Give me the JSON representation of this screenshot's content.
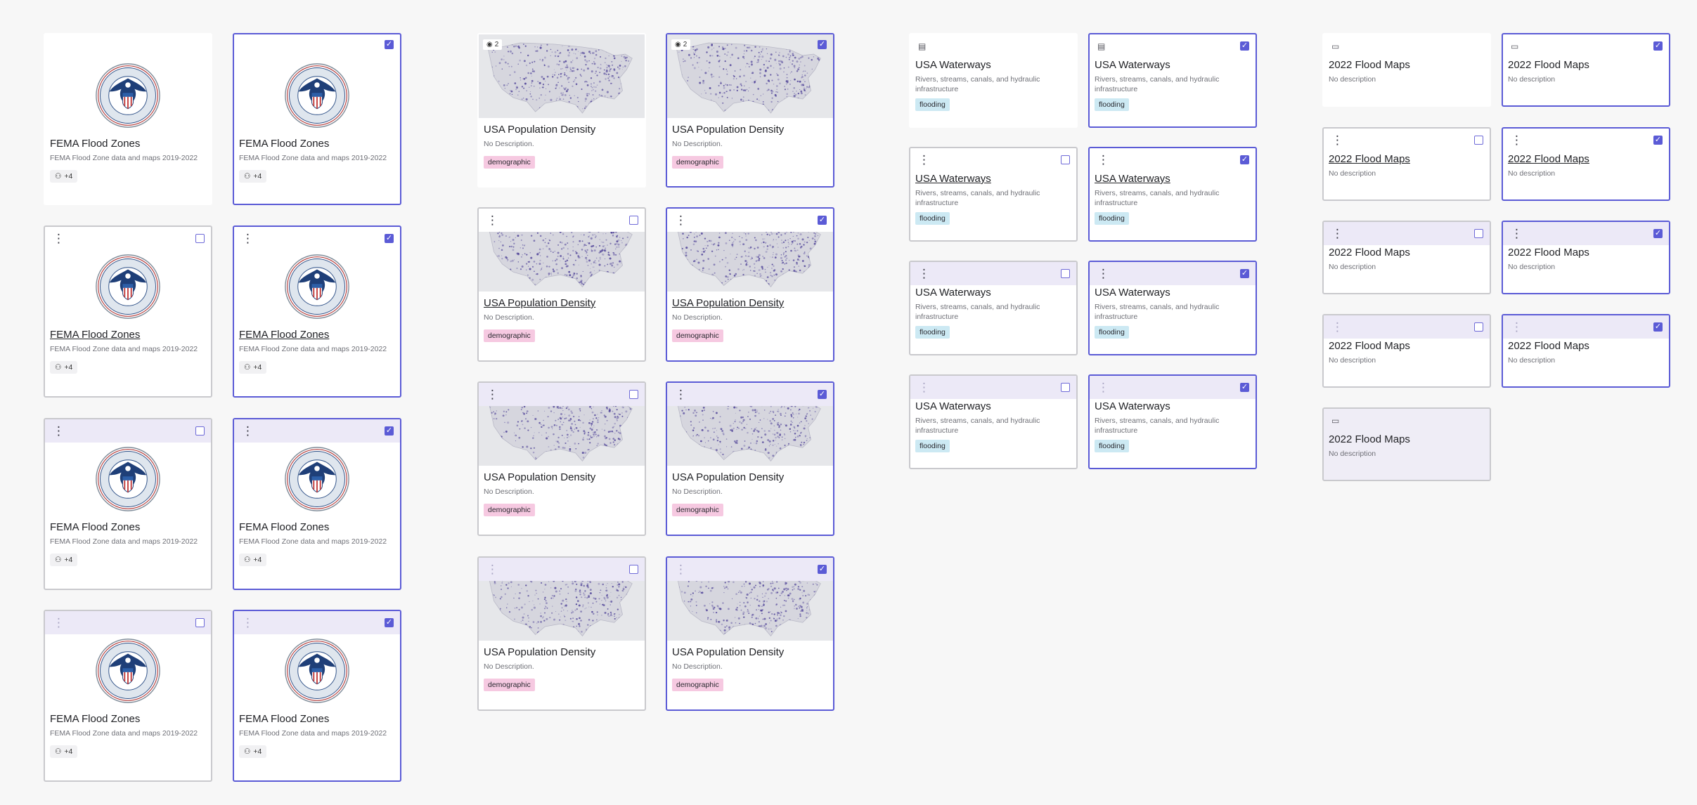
{
  "fema": {
    "title": "FEMA Flood Zones",
    "desc": "FEMA Flood Zone data and maps 2019-2022",
    "share_count": "+4",
    "menu_icon": "more-vertical-icon",
    "share_icon": "users-icon",
    "seal_icon": "dhs-seal-icon"
  },
  "density": {
    "title": "USA Population Density",
    "desc": "No Description.",
    "tag": "demographic",
    "views": "2",
    "view_icon": "eye-icon"
  },
  "waterways": {
    "title": "USA Waterways",
    "desc": "Rivers, streams, canals, and hydraulic infrastructure",
    "tag": "flooding",
    "file_icon": "document-icon"
  },
  "maps2022": {
    "title": "2022 Flood Maps",
    "desc": "No description",
    "folder_icon": "folder-icon"
  },
  "colors": {
    "accent": "#5b5bd6",
    "tag_pink": "#f6c9e1",
    "tag_blue": "#cce9f3",
    "header_tint": "#ece9f7"
  }
}
